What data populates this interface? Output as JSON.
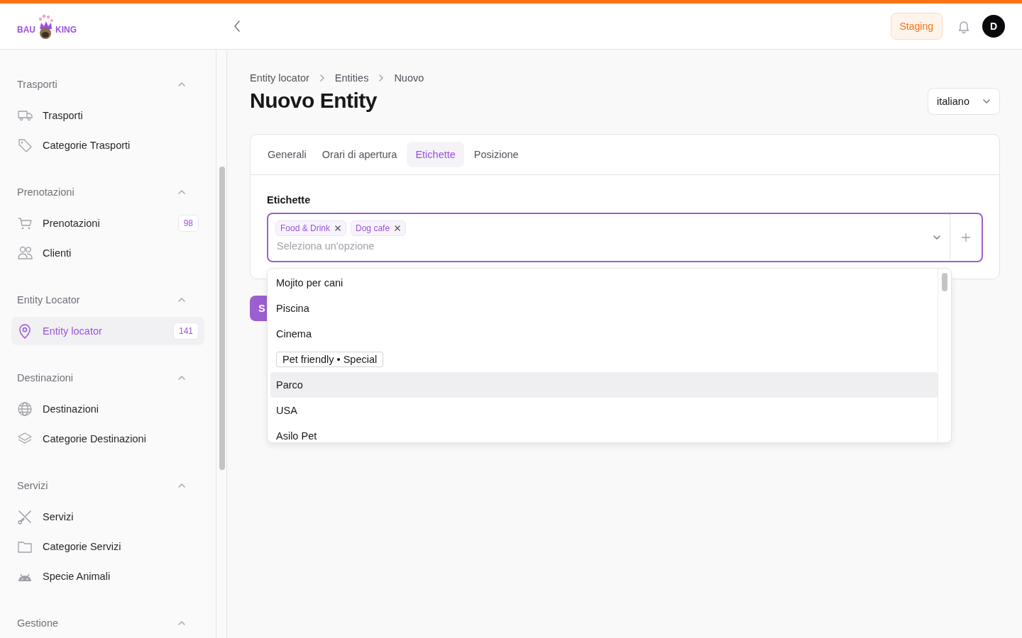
{
  "header": {
    "logo": {
      "left": "BAU",
      "right": "KING"
    },
    "environment_badge": "Staging",
    "avatar": "D"
  },
  "sidebar": {
    "groups": [
      {
        "title": "Trasporti",
        "expanded": true,
        "items": [
          {
            "label": "Trasporti",
            "selected": false
          },
          {
            "label": "Categorie Trasporti",
            "selected": false
          }
        ]
      },
      {
        "title": "Prenotazioni",
        "expanded": true,
        "items": [
          {
            "label": "Prenotazioni",
            "selected": false,
            "badge": "98"
          },
          {
            "label": "Clienti",
            "selected": false
          }
        ]
      },
      {
        "title": "Entity Locator",
        "expanded": true,
        "items": [
          {
            "label": "Entity locator",
            "selected": true,
            "badge": "141"
          }
        ]
      },
      {
        "title": "Destinazioni",
        "expanded": true,
        "items": [
          {
            "label": "Destinazioni",
            "selected": false
          },
          {
            "label": "Categorie Destinazioni",
            "selected": false
          }
        ]
      },
      {
        "title": "Servizi",
        "expanded": true,
        "items": [
          {
            "label": "Servizi",
            "selected": false
          },
          {
            "label": "Categorie Servizi",
            "selected": false
          },
          {
            "label": "Specie Animali",
            "selected": false
          }
        ]
      },
      {
        "title": "Gestione",
        "expanded": true
      }
    ]
  },
  "main": {
    "breadcrumb": [
      "Entity locator",
      "Entities",
      "Nuovo"
    ],
    "title": "Nuovo Entity",
    "language_select": {
      "value": "italiano"
    },
    "tabs": [
      {
        "label": "Generali",
        "selected": false
      },
      {
        "label": "Orari di apertura",
        "selected": false
      },
      {
        "label": "Etichette",
        "selected": true
      },
      {
        "label": "Posizione",
        "selected": false
      }
    ],
    "field": {
      "label": "Etichette",
      "chips": [
        "Food & Drink",
        "Dog cafe"
      ],
      "placeholder": "Seleziona un'opzione"
    },
    "dropdown": {
      "options": [
        {
          "label": "Mojito per cani",
          "kind": "plain",
          "highlighted": false
        },
        {
          "label": "Piscina",
          "kind": "plain",
          "highlighted": false
        },
        {
          "label": "Cinema",
          "kind": "plain",
          "highlighted": false
        },
        {
          "label": "Pet friendly • Special",
          "kind": "boxed",
          "highlighted": false
        },
        {
          "label": "Parco",
          "kind": "plain",
          "highlighted": true
        },
        {
          "label": "USA",
          "kind": "plain",
          "highlighted": false
        },
        {
          "label": "Asilo Pet",
          "kind": "plain",
          "highlighted": false
        }
      ]
    },
    "save_button": "S"
  }
}
